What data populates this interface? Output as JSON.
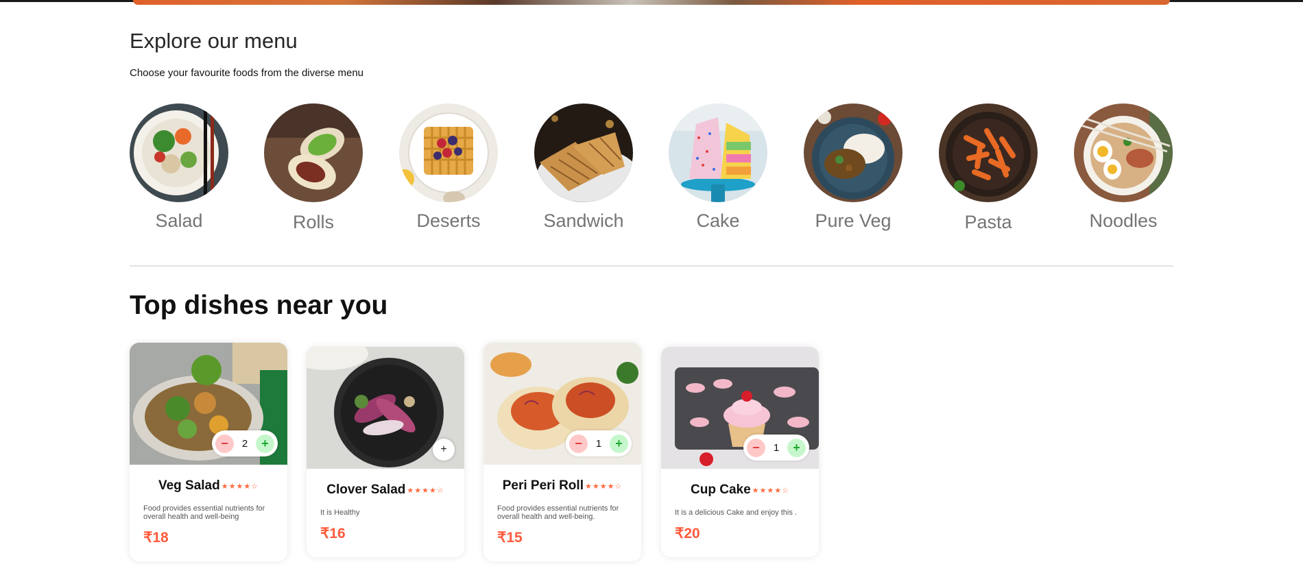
{
  "explore": {
    "title": "Explore our menu",
    "subtitle": "Choose your favourite foods from the diverse menu"
  },
  "menu": [
    {
      "label": "Salad",
      "icon": "salad-image"
    },
    {
      "label": "Rolls",
      "icon": "rolls-image"
    },
    {
      "label": "Deserts",
      "icon": "deserts-image"
    },
    {
      "label": "Sandwich",
      "icon": "sandwich-image"
    },
    {
      "label": "Cake",
      "icon": "cake-image"
    },
    {
      "label": "Pure Veg",
      "icon": "pure-veg-image"
    },
    {
      "label": "Pasta",
      "icon": "pasta-image"
    },
    {
      "label": "Noodles",
      "icon": "noodles-image"
    }
  ],
  "top_dishes": {
    "title": "Top dishes near you",
    "items": [
      {
        "name": "Veg Salad",
        "stars": "★★★★☆",
        "rating": 4,
        "desc": "Food provides essential nutrients for overall health and well-being",
        "price": "₹18",
        "count": "2"
      },
      {
        "name": "Clover Salad",
        "stars": "★★★★☆",
        "rating": 4,
        "desc": "It is Healthy",
        "price": "₹16",
        "add_label": "+"
      },
      {
        "name": "Peri Peri Roll",
        "stars": "★★★★☆",
        "rating": 4,
        "desc": "Food provides essential nutrients for overall health and well-being.",
        "price": "₹15",
        "count": "1"
      },
      {
        "name": "Cup Cake",
        "stars": "★★★★☆",
        "rating": 4,
        "desc": "It is a delicious Cake and enjoy this .",
        "price": "₹20",
        "count": "1"
      }
    ]
  },
  "counter": {
    "minus_label": "−",
    "plus_label": "+"
  },
  "colors": {
    "accent": "#ff5a3c",
    "star": "#ff6a3d",
    "minus_bg": "#ffc8c8",
    "plus_bg": "#c6f7cc"
  }
}
